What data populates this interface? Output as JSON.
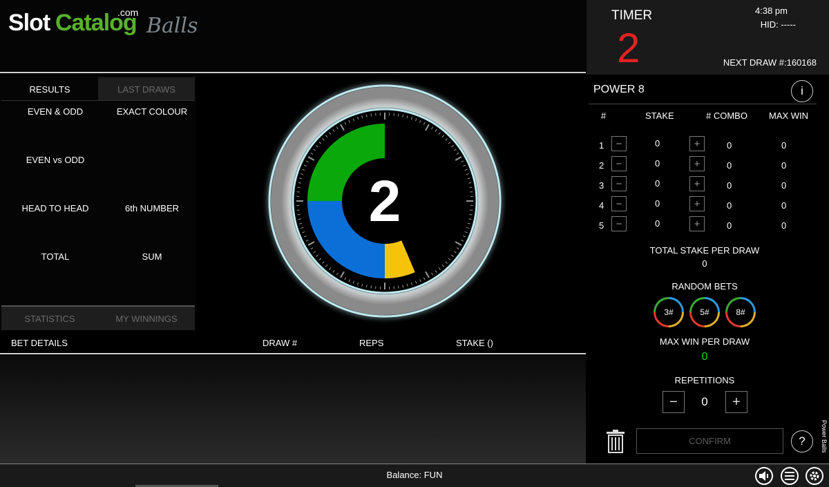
{
  "logo": {
    "part1": "Slot",
    "part2": "Catalog",
    "suffix": ".com",
    "game_script": "Balls"
  },
  "timer": {
    "label": "TIMER",
    "value": "2",
    "clock": "4:38 pm",
    "hid": "HID: -----",
    "next_draw": "NEXT DRAW #:160168"
  },
  "left_tabs": {
    "results": "RESULTS",
    "last_draws": "LAST DRAWS",
    "statistics": "STATISTICS",
    "my_winnings": "MY WINNINGS",
    "items": [
      "EVEN & ODD",
      "EXACT COLOUR",
      "EVEN vs ODD",
      "HEAD TO HEAD",
      "6th NUMBER",
      "TOTAL",
      "SUM"
    ]
  },
  "draw": {
    "countdown": "2",
    "colors": {
      "green": "#0aa80a",
      "blue": "#0a6fd6",
      "yellow": "#f5c40a"
    }
  },
  "bet_details": {
    "title": "BET DETAILS",
    "draw": "DRAW #",
    "reps": "REPS",
    "stake": "STAKE ()"
  },
  "bet_panel": {
    "title": "POWER 8",
    "info": "i",
    "headers": {
      "num": "#",
      "stake": "STAKE",
      "combo": "# COMBO",
      "max_win": "MAX WIN"
    },
    "rows": [
      {
        "n": "1",
        "stake": "0",
        "combo": "0",
        "max_win": "0"
      },
      {
        "n": "2",
        "stake": "0",
        "combo": "0",
        "max_win": "0"
      },
      {
        "n": "3",
        "stake": "0",
        "combo": "0",
        "max_win": "0"
      },
      {
        "n": "4",
        "stake": "0",
        "combo": "0",
        "max_win": "0"
      },
      {
        "n": "5",
        "stake": "0",
        "combo": "0",
        "max_win": "0"
      }
    ],
    "total_stake_label": "TOTAL STAKE PER DRAW",
    "total_stake_value": "0",
    "random_bets_label": "RANDOM BETS",
    "random_bets": [
      "3#",
      "5#",
      "8#"
    ],
    "max_win_label": "MAX WIN PER DRAW",
    "max_win_value": "0",
    "repetitions_label": "REPETITIONS",
    "repetitions_value": "0",
    "confirm": "CONFIRM",
    "help": "?",
    "minus": "−",
    "plus": "+"
  },
  "game_label": "Power Balls",
  "footer": {
    "balance": "Balance: FUN"
  },
  "icons": [
    "sound-icon",
    "menu-icon",
    "settings-icon",
    "trash-icon",
    "info-icon",
    "help-icon"
  ]
}
